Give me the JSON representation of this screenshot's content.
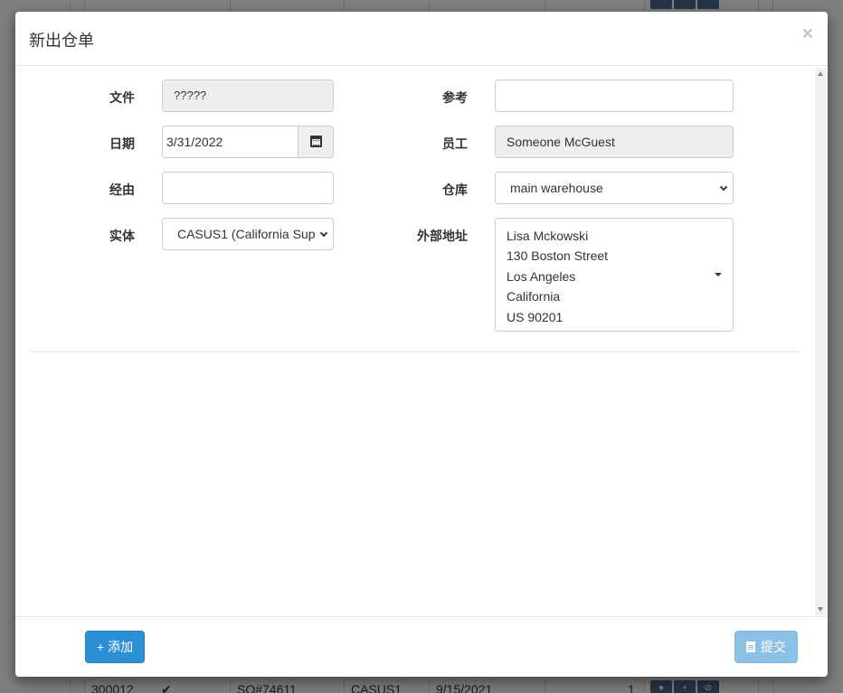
{
  "background_table": {
    "row": {
      "id": "300012",
      "check": "✔",
      "order": "SO#74611",
      "entity": "CASUS1",
      "date": "9/15/2021",
      "qty": "1"
    }
  },
  "modal": {
    "title": "新出仓单",
    "close": "×",
    "fields": {
      "document": {
        "label": "文件",
        "value": "?????"
      },
      "date": {
        "label": "日期",
        "value": "3/31/2022",
        "icon": "calendar-icon"
      },
      "via": {
        "label": "经由",
        "value": ""
      },
      "entity": {
        "label": "实体",
        "value": "CASUS1 (California Sup"
      },
      "reference": {
        "label": "参考",
        "value": ""
      },
      "employee": {
        "label": "员工",
        "value": "Someone McGuest"
      },
      "warehouse": {
        "label": "仓库",
        "value": "main warehouse"
      },
      "external_address": {
        "label": "外部地址",
        "lines": [
          "Lisa Mckowski",
          "130 Boston Street",
          "Los Angeles",
          "California",
          "US 90201"
        ]
      }
    },
    "footer": {
      "add_label": "+ 添加",
      "submit_label": "提交",
      "submit_icon": "file-icon"
    }
  },
  "colors": {
    "primary": "#2d8fd5",
    "primary_disabled": "#8cc1e6",
    "readonly_bg": "#eeeeee"
  }
}
